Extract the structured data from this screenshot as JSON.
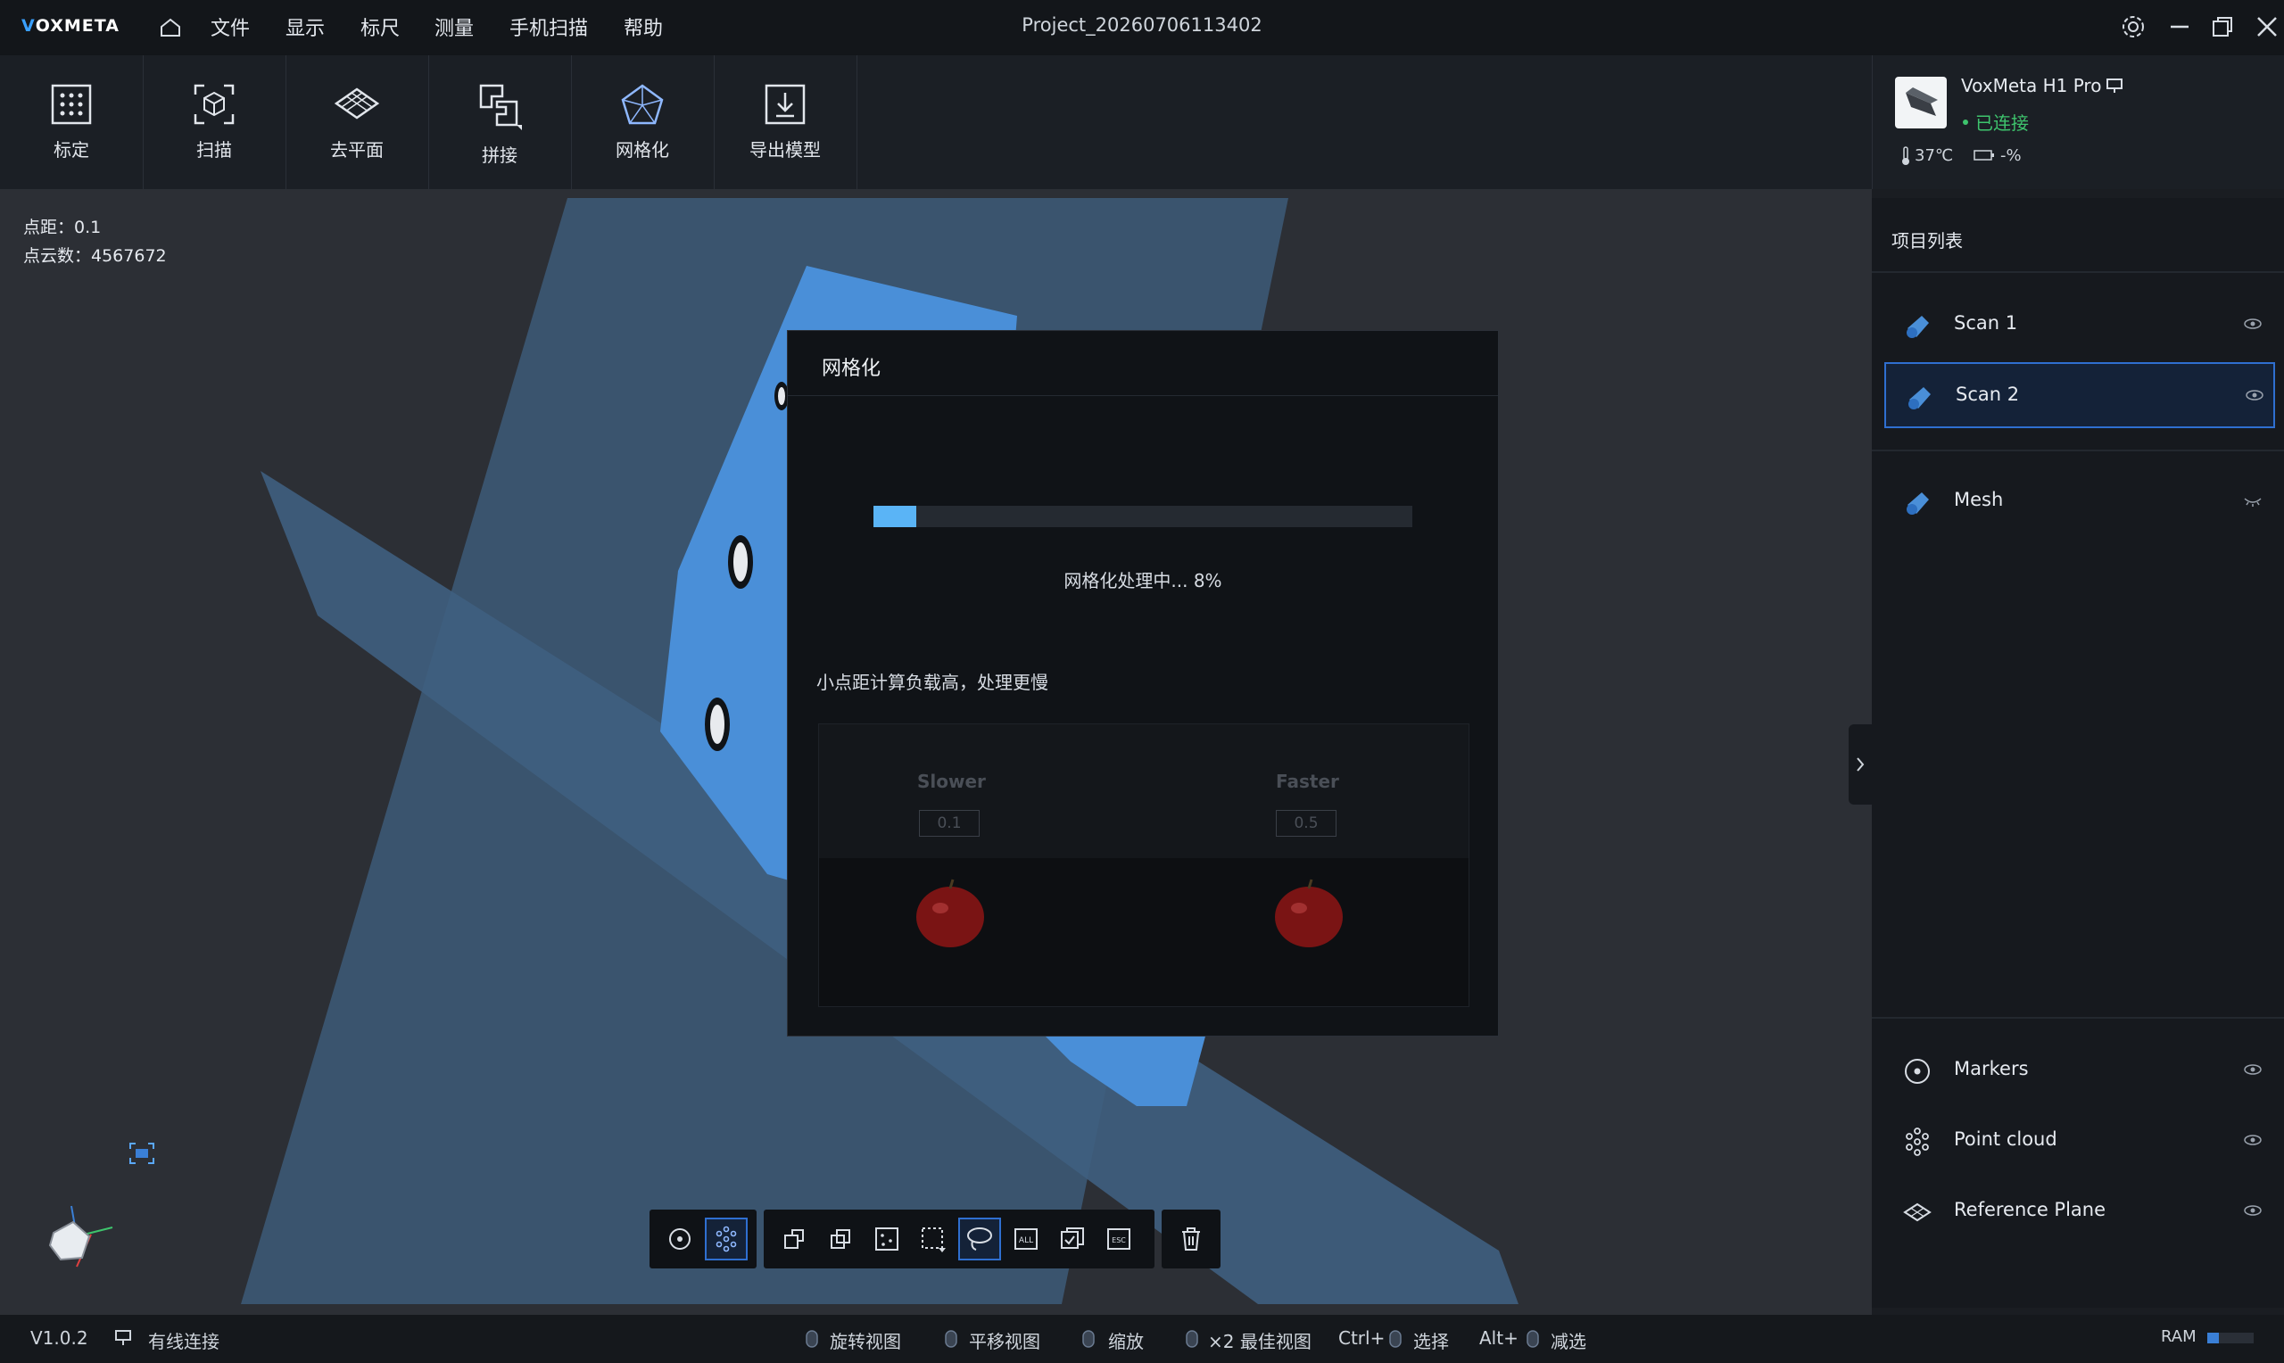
{
  "app": {
    "logo": "VOXMETA",
    "project_title": "Project_20260706113402"
  },
  "menu": [
    "文件",
    "显示",
    "标尺",
    "测量",
    "手机扫描",
    "帮助"
  ],
  "toolbar": [
    {
      "label": "标定",
      "icon": "calibration-grid-icon"
    },
    {
      "label": "扫描",
      "icon": "scan-cube-icon"
    },
    {
      "label": "去平面",
      "icon": "remove-plane-icon"
    },
    {
      "label": "拼接",
      "icon": "stitch-icon"
    },
    {
      "label": "网格化",
      "icon": "mesh-icon"
    },
    {
      "label": "导出模型",
      "icon": "export-model-icon"
    }
  ],
  "device": {
    "name": "VoxMeta H1 Pro",
    "status": "已连接",
    "temperature": "37℃",
    "battery": "-%"
  },
  "viewport": {
    "point_spacing": "点距：0.1",
    "point_count": "点云数：4567672"
  },
  "panel": {
    "title": "项目列表",
    "items": [
      {
        "name": "Scan 1",
        "visible": true
      },
      {
        "name": "Scan 2",
        "visible": true,
        "selected": true
      },
      {
        "name": "Mesh",
        "visible": false
      }
    ],
    "layers": [
      {
        "name": "Markers",
        "icon": "marker-target-icon"
      },
      {
        "name": "Point cloud",
        "icon": "point-cloud-icon"
      },
      {
        "name": "Reference Plane",
        "icon": "reference-plane-icon"
      }
    ]
  },
  "dialog": {
    "title": "网格化",
    "progress": 0.08,
    "progress_text": "网格化处理中... 8%",
    "hint": "小点距计算负载高，处理更慢",
    "slower_label": "Slower",
    "slower_value": "0.1",
    "faster_label": "Faster",
    "faster_value": "0.5"
  },
  "statusbar": {
    "version": "V1.0.2",
    "connection": "有线连接",
    "rotate": "旋转视图",
    "pan": "平移视图",
    "zoom": "缩放",
    "best_view": "×2 最佳视图",
    "select_key": "Ctrl+",
    "select": "选择",
    "deselect_key": "Alt+",
    "deselect": "减选",
    "ram_label": "RAM",
    "ram_usage": 0.25
  },
  "colors": {
    "accent": "#3aa0ff",
    "selected_border": "#2f6fd0",
    "scan_blue": "#4a8fd8",
    "connected_green": "#3ec46d"
  }
}
